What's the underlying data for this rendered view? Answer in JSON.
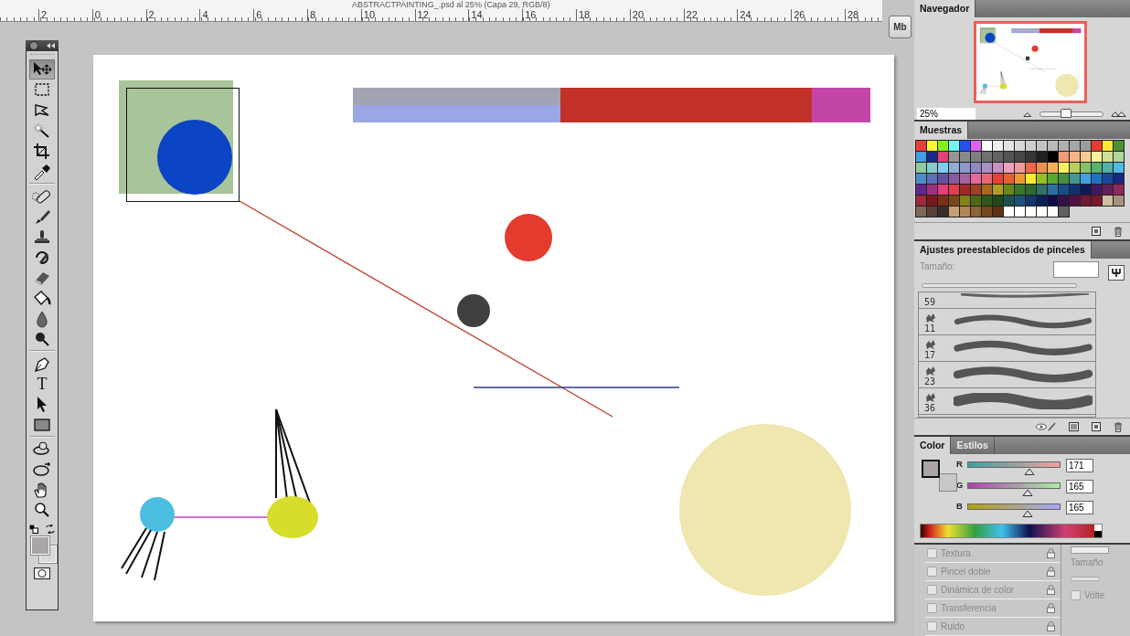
{
  "document": {
    "title": "ABSTRACTPAINTING_.psd al 25% (Capa 29, RGB/8)"
  },
  "ruler": {
    "labels": [
      "2",
      "0",
      "2",
      "4",
      "6",
      "8",
      "10",
      "12",
      "14",
      "16",
      "18",
      "20",
      "22",
      "24",
      "26",
      "28"
    ]
  },
  "dock": {
    "button": "Mb"
  },
  "tools": [
    {
      "kind": "move",
      "selected": true
    },
    {
      "kind": "marquee",
      "selected": false
    },
    {
      "kind": "lasso",
      "selected": false
    },
    {
      "kind": "wand",
      "selected": false
    },
    {
      "kind": "crop",
      "selected": false
    },
    {
      "kind": "eyedropper",
      "selected": false
    },
    {
      "kind": "separator"
    },
    {
      "kind": "healing",
      "selected": false
    },
    {
      "kind": "brush",
      "selected": false
    },
    {
      "kind": "stamp",
      "selected": false
    },
    {
      "kind": "history",
      "selected": false
    },
    {
      "kind": "eraser",
      "selected": false
    },
    {
      "kind": "bucket",
      "selected": false
    },
    {
      "kind": "blur",
      "selected": false
    },
    {
      "kind": "dodge",
      "selected": false
    },
    {
      "kind": "separator"
    },
    {
      "kind": "pen",
      "selected": false
    },
    {
      "kind": "type",
      "glyph": "T",
      "selected": false
    },
    {
      "kind": "path",
      "selected": false
    },
    {
      "kind": "shape",
      "selected": false
    },
    {
      "kind": "separator"
    },
    {
      "kind": "rotate3d",
      "selected": false
    },
    {
      "kind": "orbit3d",
      "selected": false
    },
    {
      "kind": "hand",
      "selected": false
    },
    {
      "kind": "zoom",
      "selected": false
    }
  ],
  "navigator": {
    "tab": "Navegador",
    "zoom": "25%",
    "level": 0.4
  },
  "swatches": {
    "tab": "Muestras",
    "colors": [
      {
        "color": "#e8403a"
      },
      {
        "color": "#fdf53a"
      },
      {
        "color": "#80f020"
      },
      {
        "color": "#70f8f8"
      },
      {
        "color": "#2850f8"
      },
      {
        "color": "#e060f0"
      },
      {
        "color": "#ffffff"
      },
      {
        "color": "#eeeeee"
      },
      {
        "color": "#e2e2e2"
      },
      {
        "color": "#d8d8d8"
      },
      {
        "color": "#cecece"
      },
      {
        "color": "#c4c4c4"
      },
      {
        "color": "#bababa"
      },
      {
        "color": "#b0b0b0"
      },
      {
        "color": "#a6a6a6"
      },
      {
        "color": "#9c9c9c"
      },
      {
        "color": "#e63d32"
      },
      {
        "color": "#fbe936"
      },
      {
        "color": "#4c9038"
      },
      {
        "color": "#3f9ee0"
      },
      {
        "color": "#1a2a88"
      },
      {
        "color": "#e2407a"
      },
      {
        "color": "#969696"
      },
      {
        "color": "#8a8a8a"
      },
      {
        "color": "#7e7e7e"
      },
      {
        "color": "#707070"
      },
      {
        "color": "#626262"
      },
      {
        "color": "#545454"
      },
      {
        "color": "#464646"
      },
      {
        "color": "#363636"
      },
      {
        "color": "#202020"
      },
      {
        "color": "#000000"
      },
      {
        "color": "#f0987a"
      },
      {
        "color": "#f4b484"
      },
      {
        "color": "#f8cc90"
      },
      {
        "color": "#fcf49c"
      },
      {
        "color": "#d0e09c"
      },
      {
        "color": "#b0d89c"
      },
      {
        "color": "#92c89a"
      },
      {
        "color": "#88cccc"
      },
      {
        "color": "#80ccec"
      },
      {
        "color": "#90acd8"
      },
      {
        "color": "#8c98cc"
      },
      {
        "color": "#9088c0"
      },
      {
        "color": "#a890c0"
      },
      {
        "color": "#c890c0"
      },
      {
        "color": "#eca0c0"
      },
      {
        "color": "#ec9c98"
      },
      {
        "color": "#ec6848"
      },
      {
        "color": "#f09050"
      },
      {
        "color": "#f4b058"
      },
      {
        "color": "#fcf058"
      },
      {
        "color": "#b8d060"
      },
      {
        "color": "#88c068"
      },
      {
        "color": "#58b070"
      },
      {
        "color": "#50b0a8"
      },
      {
        "color": "#50b8e8"
      },
      {
        "color": "#4a8ec8"
      },
      {
        "color": "#5870b8"
      },
      {
        "color": "#6050a0"
      },
      {
        "color": "#8858a0"
      },
      {
        "color": "#a860a0"
      },
      {
        "color": "#e8689c"
      },
      {
        "color": "#e86878"
      },
      {
        "color": "#e84038"
      },
      {
        "color": "#e86030"
      },
      {
        "color": "#f09830"
      },
      {
        "color": "#fce830"
      },
      {
        "color": "#98c020"
      },
      {
        "color": "#58a830"
      },
      {
        "color": "#489040"
      },
      {
        "color": "#409890"
      },
      {
        "color": "#40a0e0"
      },
      {
        "color": "#2070c0"
      },
      {
        "color": "#1848a0"
      },
      {
        "color": "#182880"
      },
      {
        "color": "#602888"
      },
      {
        "color": "#a03080"
      },
      {
        "color": "#e04078"
      },
      {
        "color": "#e04050"
      },
      {
        "color": "#a02828"
      },
      {
        "color": "#a04020"
      },
      {
        "color": "#a86820"
      },
      {
        "color": "#b0a020"
      },
      {
        "color": "#688818"
      },
      {
        "color": "#387828"
      },
      {
        "color": "#306830"
      },
      {
        "color": "#307068"
      },
      {
        "color": "#2870a0"
      },
      {
        "color": "#184c88"
      },
      {
        "color": "#103070"
      },
      {
        "color": "#101858"
      },
      {
        "color": "#401860"
      },
      {
        "color": "#602058"
      },
      {
        "color": "#902858"
      },
      {
        "color": "#a02838"
      },
      {
        "color": "#781818"
      },
      {
        "color": "#783018"
      },
      {
        "color": "#784818"
      },
      {
        "color": "#888018"
      },
      {
        "color": "#506818"
      },
      {
        "color": "#305818"
      },
      {
        "color": "#204818"
      },
      {
        "color": "#205050"
      },
      {
        "color": "#205078"
      },
      {
        "color": "#103868"
      },
      {
        "color": "#082058"
      },
      {
        "color": "#100c48"
      },
      {
        "color": "#381048"
      },
      {
        "color": "#501040"
      },
      {
        "color": "#701838"
      },
      {
        "color": "#781828"
      },
      {
        "color": "#d0c0a0"
      },
      {
        "color": "#a89080"
      },
      {
        "color": "#806858"
      },
      {
        "color": "#584038"
      },
      {
        "color": "#383028"
      },
      {
        "color": "#c8a070"
      },
      {
        "color": "#b08858"
      },
      {
        "color": "#906038"
      },
      {
        "color": "#784820"
      },
      {
        "color": "#603010"
      },
      {
        "color": "#fffffe"
      },
      {
        "color": "#fffffd"
      },
      {
        "color": "#fffffc"
      },
      {
        "color": "#fffffb"
      },
      {
        "color": "#fffffa"
      },
      {
        "color": "#606060"
      }
    ]
  },
  "brush_presets": {
    "tab": "Ajustes preestablecidos de pinceles",
    "size_label": "Tamaño:",
    "size_slider": {
      "level": 0
    },
    "brushes": [
      {
        "size": "59",
        "kind": "soft"
      },
      {
        "size": "11",
        "kind": "rough"
      },
      {
        "size": "17",
        "kind": "rough"
      },
      {
        "size": "23",
        "kind": "rough"
      },
      {
        "size": "36",
        "kind": "rough"
      }
    ]
  },
  "color": {
    "tabs": [
      {
        "label": "Color",
        "selected": true
      },
      {
        "label": "Estilos",
        "selected": false
      }
    ],
    "channels": [
      {
        "name": "R",
        "value": "171",
        "level": 0.67
      },
      {
        "name": "G",
        "value": "165",
        "level": 0.65
      },
      {
        "name": "B",
        "value": "165",
        "level": 0.65
      }
    ]
  },
  "brush_options": {
    "items": [
      {
        "label": "Textura",
        "checked": false
      },
      {
        "label": "Pincel doble",
        "checked": false
      },
      {
        "label": "Dinámica de color",
        "checked": false
      },
      {
        "label": "Transferencia",
        "checked": false
      },
      {
        "label": "Ruido",
        "checked": false
      }
    ],
    "size_label": "Tamaño",
    "size_slider": {
      "level": 0
    },
    "flip": {
      "label": "Volte",
      "checked": false
    }
  }
}
